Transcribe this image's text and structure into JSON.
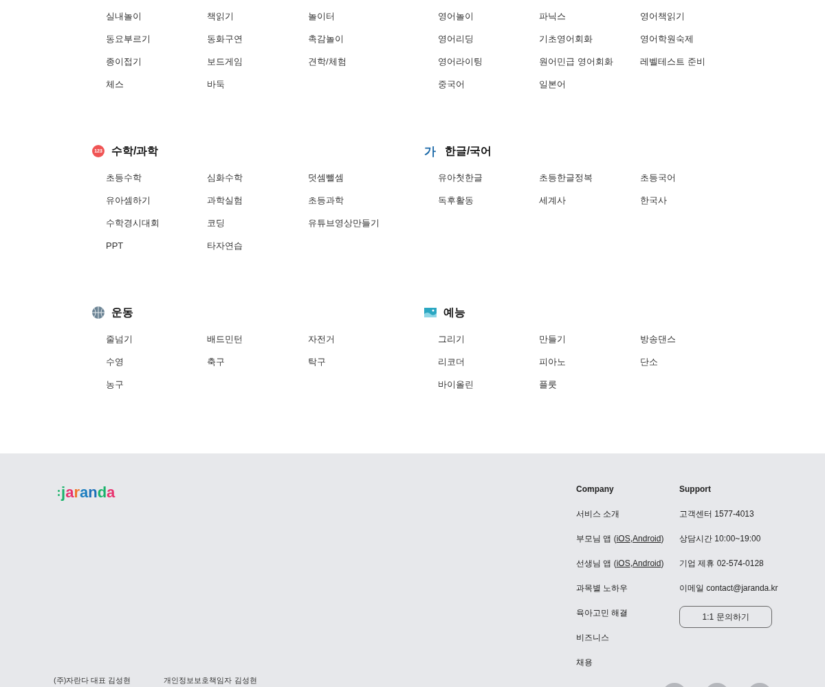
{
  "sections": [
    [
      {
        "items": [
          "실내놀이",
          "책읽기",
          "놀이터",
          "동요부르기",
          "동화구연",
          "촉감놀이",
          "종이접기",
          "보드게임",
          "견학/체험",
          "체스",
          "바둑"
        ]
      },
      {
        "items": [
          "영어놀이",
          "파닉스",
          "영어책읽기",
          "영어리딩",
          "기초영어회화",
          "영어학원숙제",
          "영어라이팅",
          "원어민급 영어회화",
          "레벨테스트 준비",
          "중국어",
          "일본어"
        ]
      }
    ],
    [
      {
        "title": "수학/과학",
        "icon": {
          "kind": "badge",
          "text": "123"
        },
        "items": [
          "초등수학",
          "심화수학",
          "덧셈뺄셈",
          "유아셈하기",
          "과학실험",
          "초등과학",
          "수학경시대회",
          "코딩",
          "유튜브영상만들기",
          "PPT",
          "타자연습"
        ]
      },
      {
        "title": "한글/국어",
        "icon": {
          "kind": "glyph",
          "text": "가"
        },
        "items": [
          "유아첫한글",
          "초등한글정복",
          "초등국어",
          "독후활동",
          "세계사",
          "한국사"
        ]
      }
    ],
    [
      {
        "title": "운동",
        "icon": {
          "kind": "ball"
        },
        "items": [
          "줄넘기",
          "배드민턴",
          "자전거",
          "수영",
          "축구",
          "탁구",
          "농구"
        ]
      },
      {
        "title": "예능",
        "icon": {
          "kind": "picture"
        },
        "items": [
          "그리기",
          "만들기",
          "방송댄스",
          "리코더",
          "피아노",
          "단소",
          "바이올린",
          "플룻"
        ]
      }
    ]
  ],
  "footer": {
    "logo": "jaranda",
    "company": {
      "heading": "Company",
      "items": [
        {
          "text": "서비스 소개"
        },
        {
          "text": "부모님 앱 (",
          "links": [
            "iOS",
            "Android"
          ],
          "separator": ",",
          "suffix": ")"
        },
        {
          "text": "선생님 앱 (",
          "links": [
            "iOS",
            "Android"
          ],
          "separator": ",",
          "suffix": ")"
        },
        {
          "text": "과목별 노하우"
        },
        {
          "text": "육아고민 해결"
        },
        {
          "text": "비즈니스"
        },
        {
          "text": "채용"
        }
      ]
    },
    "support": {
      "heading": "Support",
      "items": [
        "고객센터 1577-4013",
        "상담시간 10:00~19:00",
        "기업 제휴 02-574-0128",
        "이메일 contact@jaranda.kr"
      ],
      "button": "1:1 문의하기"
    },
    "legal": [
      "(주)자란다 대표 김성현",
      "개인정보보호책임자 김성현"
    ]
  }
}
